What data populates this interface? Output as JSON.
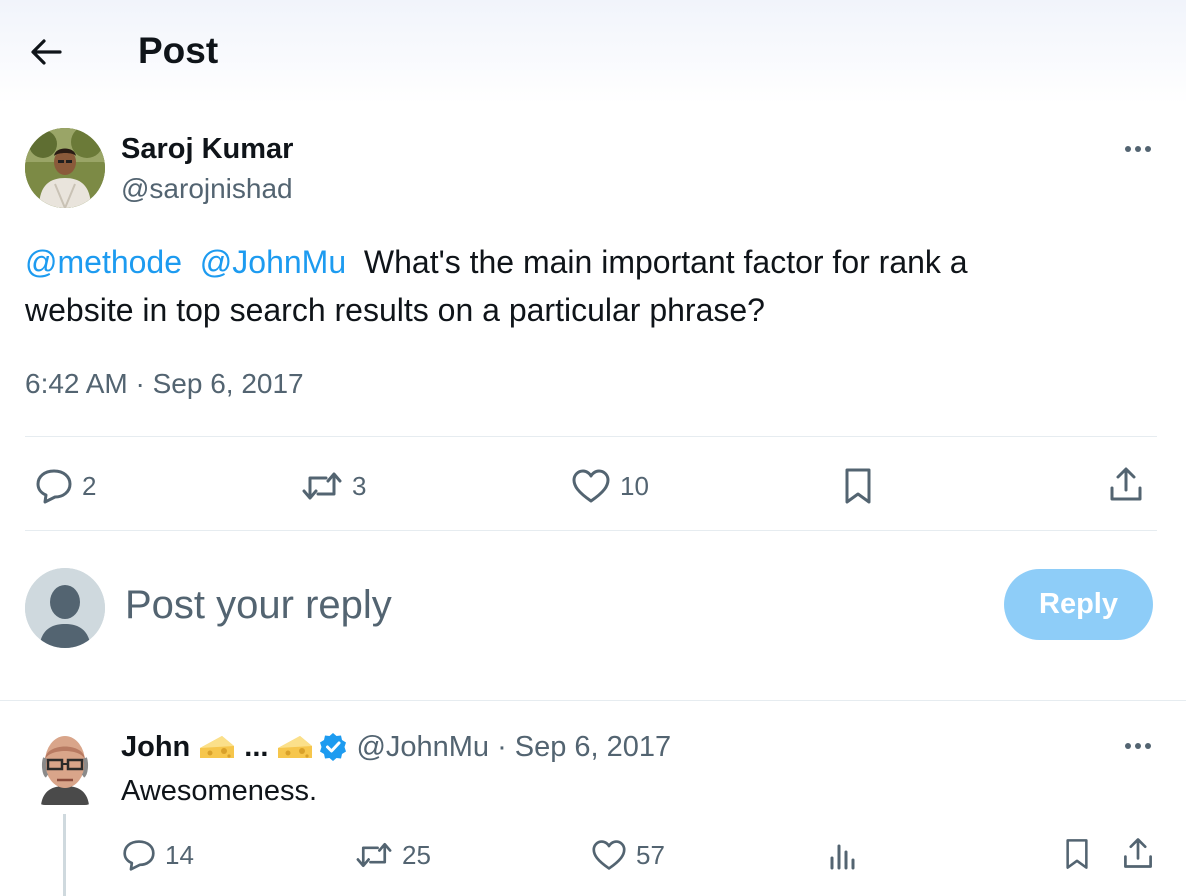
{
  "header": {
    "title": "Post"
  },
  "tweet": {
    "author_name": "Saroj Kumar",
    "author_handle": "@sarojnishad",
    "mentions": [
      "@methode",
      "@JohnMu"
    ],
    "text_line1": "What's the main important factor for rank a",
    "text_line2": "website in top search results on a particular phrase?",
    "timestamp": "6:42 AM · Sep 6, 2017",
    "replies": "2",
    "reposts": "3",
    "likes": "10"
  },
  "compose": {
    "placeholder": "Post your reply",
    "button_label": "Reply"
  },
  "reply": {
    "author_name": "John",
    "ellipsis": "...",
    "author_handle": "@JohnMu",
    "separator": "·",
    "date": "Sep 6, 2017",
    "text": "Awesomeness.",
    "replies": "14",
    "reposts": "25",
    "likes": "57"
  },
  "icons": {
    "back": "arrow-left-icon",
    "more": "more-horizontal-icon",
    "reply": "speech-bubble-icon",
    "repost": "repost-arrows-icon",
    "like": "heart-icon",
    "bookmark": "bookmark-icon",
    "share": "share-icon",
    "views": "bar-chart-icon",
    "verified": "verified-badge-icon",
    "emoji": "cheese-emoji"
  },
  "colors": {
    "link": "#1d9bf0",
    "secondary_text": "#536471",
    "reply_button_disabled": "#8ecdf8",
    "verified": "#1d9bf0"
  }
}
